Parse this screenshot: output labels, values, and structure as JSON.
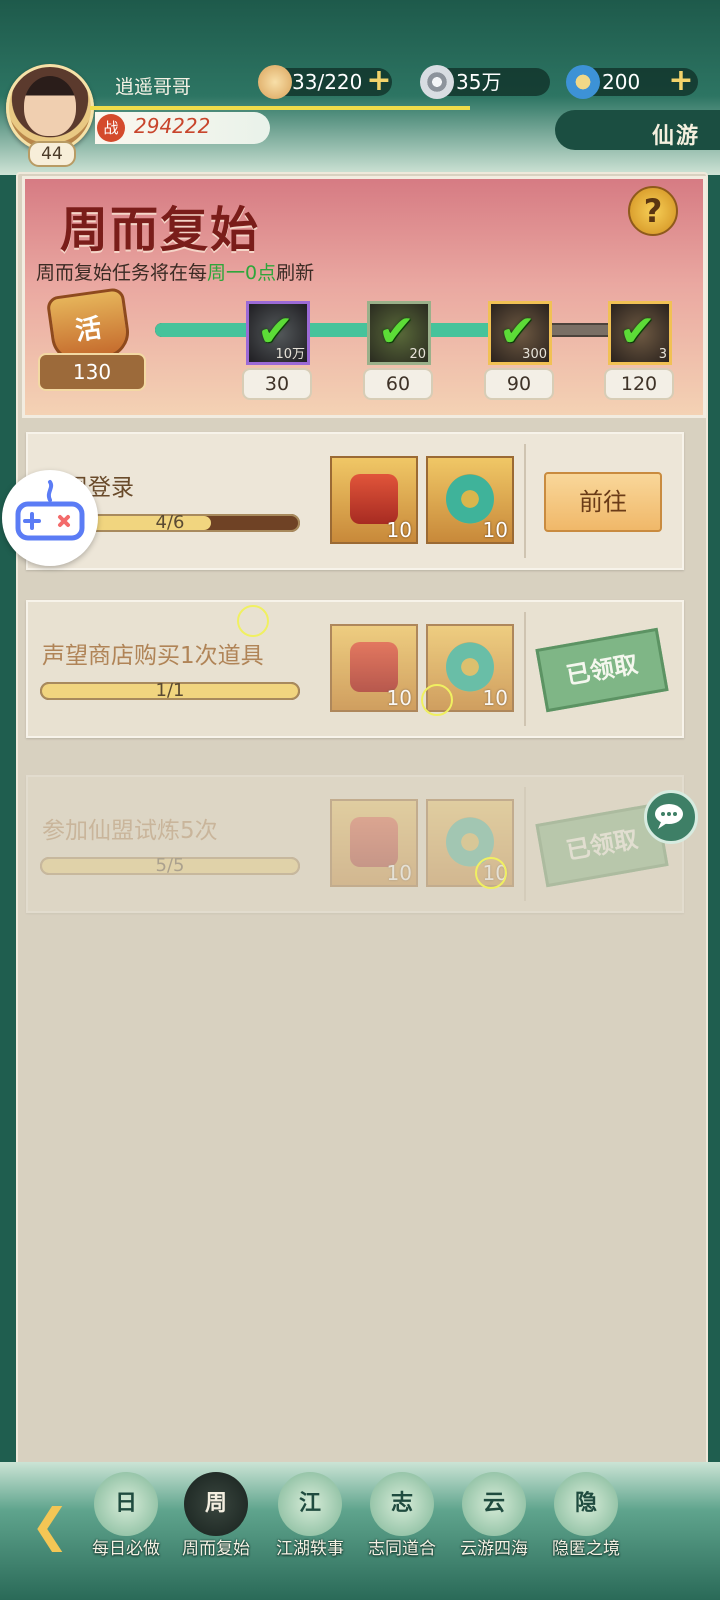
{
  "player": {
    "name": "逍遥哥哥",
    "level": "44",
    "power": "294222",
    "power_icon": "战"
  },
  "resources": [
    {
      "icon": "bun-icon",
      "value": "33/220",
      "color": "#f1c27d"
    },
    {
      "icon": "coin-icon",
      "value": "35万",
      "color": "#c9ced4"
    },
    {
      "icon": "jade-icon",
      "value": "200",
      "color": "#5aa9e6"
    }
  ],
  "server": "仙游",
  "banner": {
    "title": "周而复始",
    "desc_prefix": "周而复始任务将在每",
    "desc_highlight": "周一0点",
    "desc_suffix": "刷新",
    "activity_points": "130",
    "progress_fraction": 0.69,
    "milestones": [
      {
        "points": "30",
        "reward_amount": "10万",
        "claimed": true
      },
      {
        "points": "60",
        "reward_amount": "20",
        "claimed": true
      },
      {
        "points": "90",
        "reward_amount": "300",
        "claimed": true
      },
      {
        "points": "120",
        "reward_amount": "3",
        "claimed": true
      }
    ]
  },
  "tasks": [
    {
      "title": "每周登录",
      "progress": "4/6",
      "progress_fraction": 0.667,
      "rewards": [
        "10",
        "10"
      ],
      "action": "前往",
      "state": "go"
    },
    {
      "title": "声望商店购买1次道具",
      "progress": "1/1",
      "progress_fraction": 1.0,
      "rewards": [
        "10",
        "10"
      ],
      "action": "已领取",
      "state": "claimed"
    },
    {
      "title": "参加仙盟试炼5次",
      "progress": "5/5",
      "progress_fraction": 1.0,
      "rewards": [
        "10",
        "10"
      ],
      "action": "已领取",
      "state": "claimed"
    }
  ],
  "nav": {
    "back_icon": "arrow-left-icon",
    "tabs": [
      {
        "label": "每日必做",
        "glyph": "日",
        "active": false
      },
      {
        "label": "周而复始",
        "glyph": "周",
        "active": true
      },
      {
        "label": "江湖轶事",
        "glyph": "江",
        "active": false
      },
      {
        "label": "志同道合",
        "glyph": "志",
        "active": false
      },
      {
        "label": "云游四海",
        "glyph": "云",
        "active": false
      },
      {
        "label": "隐匿之境",
        "glyph": "隐",
        "active": false
      }
    ]
  }
}
